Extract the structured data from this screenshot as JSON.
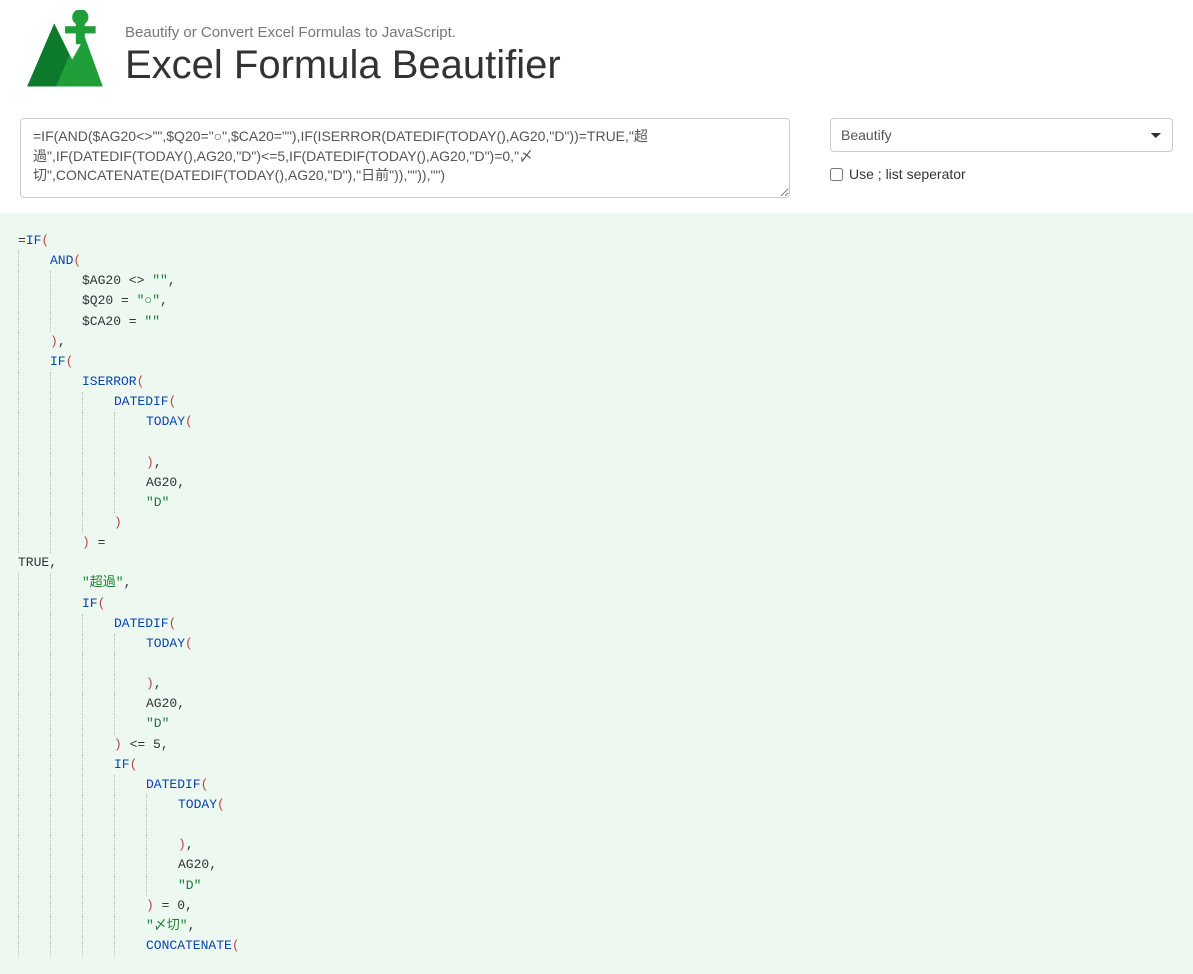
{
  "header": {
    "tagline": "Beautify or Convert Excel Formulas to JavaScript.",
    "title": "Excel Formula Beautifier"
  },
  "input": {
    "formula": "=IF(AND($AG20<>\"\",$Q20=\"○\",$CA20=\"\"),IF(ISERROR(DATEDIF(TODAY(),AG20,\"D\"))=TRUE,\"超過\",IF(DATEDIF(TODAY(),AG20,\"D\")<=5,IF(DATEDIF(TODAY(),AG20,\"D\")=0,\"〆切\",CONCATENATE(DATEDIF(TODAY(),AG20,\"D\"),\"日前\")),\"\")),\"\")"
  },
  "controls": {
    "mode_selected": "Beautify",
    "mode_options": [
      "Beautify"
    ],
    "use_semicolon_label": "Use ; list seperator",
    "use_semicolon_checked": false
  },
  "output": {
    "lines": [
      {
        "indent": 0,
        "guides": 0,
        "tokens": [
          {
            "t": "eq",
            "v": "="
          },
          {
            "t": "fn",
            "v": "IF"
          },
          {
            "t": "paren",
            "v": "("
          }
        ]
      },
      {
        "indent": 1,
        "guides": 1,
        "tokens": [
          {
            "t": "fn",
            "v": "AND"
          },
          {
            "t": "paren",
            "v": "("
          }
        ]
      },
      {
        "indent": 2,
        "guides": 2,
        "tokens": [
          {
            "t": "op",
            "v": "$AG20 <> "
          },
          {
            "t": "str",
            "v": "\"\""
          },
          {
            "t": "op",
            "v": ","
          }
        ]
      },
      {
        "indent": 2,
        "guides": 2,
        "tokens": [
          {
            "t": "op",
            "v": "$Q20 = "
          },
          {
            "t": "str",
            "v": "\"○\""
          },
          {
            "t": "op",
            "v": ","
          }
        ]
      },
      {
        "indent": 2,
        "guides": 2,
        "tokens": [
          {
            "t": "op",
            "v": "$CA20 = "
          },
          {
            "t": "str",
            "v": "\"\""
          }
        ]
      },
      {
        "indent": 1,
        "guides": 1,
        "tokens": [
          {
            "t": "paren",
            "v": ")"
          },
          {
            "t": "op",
            "v": ","
          }
        ]
      },
      {
        "indent": 1,
        "guides": 1,
        "tokens": [
          {
            "t": "fn",
            "v": "IF"
          },
          {
            "t": "paren",
            "v": "("
          }
        ]
      },
      {
        "indent": 2,
        "guides": 2,
        "tokens": [
          {
            "t": "fn",
            "v": "ISERROR"
          },
          {
            "t": "paren",
            "v": "("
          }
        ]
      },
      {
        "indent": 3,
        "guides": 3,
        "tokens": [
          {
            "t": "fn",
            "v": "DATEDIF"
          },
          {
            "t": "paren",
            "v": "("
          }
        ]
      },
      {
        "indent": 4,
        "guides": 4,
        "tokens": [
          {
            "t": "fn",
            "v": "TODAY"
          },
          {
            "t": "paren",
            "v": "("
          }
        ]
      },
      {
        "indent": 0,
        "guides": 4,
        "blank": true,
        "tokens": []
      },
      {
        "indent": 4,
        "guides": 4,
        "tokens": [
          {
            "t": "paren",
            "v": ")"
          },
          {
            "t": "op",
            "v": ","
          }
        ]
      },
      {
        "indent": 4,
        "guides": 4,
        "tokens": [
          {
            "t": "op",
            "v": "AG20,"
          }
        ]
      },
      {
        "indent": 4,
        "guides": 4,
        "tokens": [
          {
            "t": "str",
            "v": "\"D\""
          }
        ]
      },
      {
        "indent": 3,
        "guides": 3,
        "tokens": [
          {
            "t": "paren",
            "v": ")"
          }
        ]
      },
      {
        "indent": 2,
        "guides": 2,
        "tokens": [
          {
            "t": "paren",
            "v": ")"
          },
          {
            "t": "op",
            "v": " ="
          }
        ]
      },
      {
        "indent": 0,
        "guides": 0,
        "tokens": [
          {
            "t": "op",
            "v": "TRUE,"
          }
        ]
      },
      {
        "indent": 2,
        "guides": 2,
        "tokens": [
          {
            "t": "str",
            "v": "\"超過\""
          },
          {
            "t": "op",
            "v": ","
          }
        ]
      },
      {
        "indent": 2,
        "guides": 2,
        "tokens": [
          {
            "t": "fn",
            "v": "IF"
          },
          {
            "t": "paren",
            "v": "("
          }
        ]
      },
      {
        "indent": 3,
        "guides": 3,
        "tokens": [
          {
            "t": "fn",
            "v": "DATEDIF"
          },
          {
            "t": "paren",
            "v": "("
          }
        ]
      },
      {
        "indent": 4,
        "guides": 4,
        "tokens": [
          {
            "t": "fn",
            "v": "TODAY"
          },
          {
            "t": "paren",
            "v": "("
          }
        ]
      },
      {
        "indent": 0,
        "guides": 4,
        "blank": true,
        "tokens": []
      },
      {
        "indent": 4,
        "guides": 4,
        "tokens": [
          {
            "t": "paren",
            "v": ")"
          },
          {
            "t": "op",
            "v": ","
          }
        ]
      },
      {
        "indent": 4,
        "guides": 4,
        "tokens": [
          {
            "t": "op",
            "v": "AG20,"
          }
        ]
      },
      {
        "indent": 4,
        "guides": 4,
        "tokens": [
          {
            "t": "str",
            "v": "\"D\""
          }
        ]
      },
      {
        "indent": 3,
        "guides": 3,
        "tokens": [
          {
            "t": "paren",
            "v": ")"
          },
          {
            "t": "op",
            "v": " <= 5,"
          }
        ]
      },
      {
        "indent": 3,
        "guides": 3,
        "tokens": [
          {
            "t": "fn",
            "v": "IF"
          },
          {
            "t": "paren",
            "v": "("
          }
        ]
      },
      {
        "indent": 4,
        "guides": 4,
        "tokens": [
          {
            "t": "fn",
            "v": "DATEDIF"
          },
          {
            "t": "paren",
            "v": "("
          }
        ]
      },
      {
        "indent": 5,
        "guides": 5,
        "tokens": [
          {
            "t": "fn",
            "v": "TODAY"
          },
          {
            "t": "paren",
            "v": "("
          }
        ]
      },
      {
        "indent": 0,
        "guides": 5,
        "blank": true,
        "tokens": []
      },
      {
        "indent": 5,
        "guides": 5,
        "tokens": [
          {
            "t": "paren",
            "v": ")"
          },
          {
            "t": "op",
            "v": ","
          }
        ]
      },
      {
        "indent": 5,
        "guides": 5,
        "tokens": [
          {
            "t": "op",
            "v": "AG20,"
          }
        ]
      },
      {
        "indent": 5,
        "guides": 5,
        "tokens": [
          {
            "t": "str",
            "v": "\"D\""
          }
        ]
      },
      {
        "indent": 4,
        "guides": 4,
        "tokens": [
          {
            "t": "paren",
            "v": ")"
          },
          {
            "t": "op",
            "v": " = 0,"
          }
        ]
      },
      {
        "indent": 4,
        "guides": 4,
        "tokens": [
          {
            "t": "str",
            "v": "\"〆切\""
          },
          {
            "t": "op",
            "v": ","
          }
        ]
      },
      {
        "indent": 4,
        "guides": 4,
        "tokens": [
          {
            "t": "fn",
            "v": "CONCATENATE"
          },
          {
            "t": "paren",
            "v": "("
          }
        ]
      }
    ]
  }
}
